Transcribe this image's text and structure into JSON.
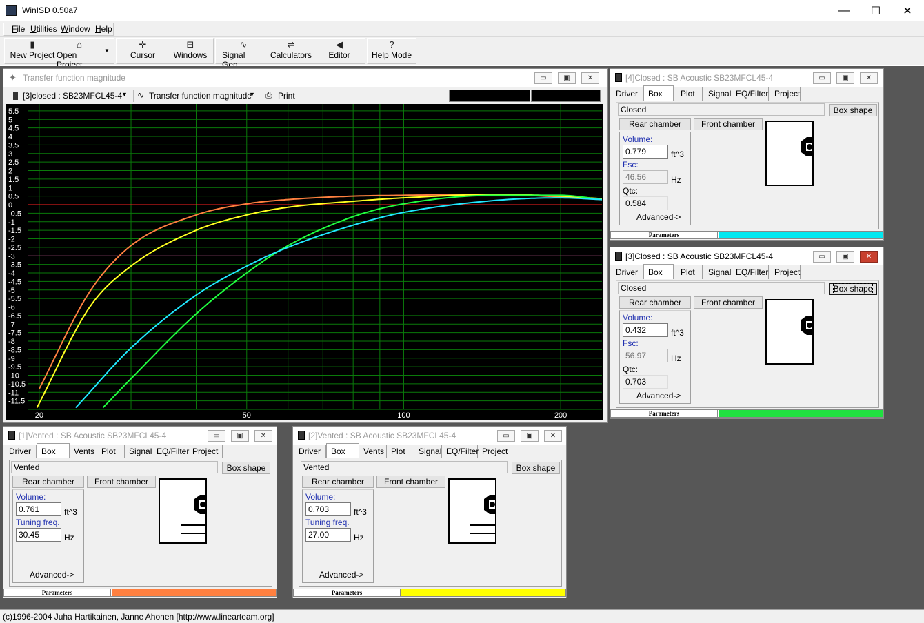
{
  "app": {
    "title": "WinISD 0.50a7",
    "window_controls": [
      "—",
      "☐",
      "✕"
    ]
  },
  "menu": [
    "File",
    "Utilities",
    "Window",
    "Help"
  ],
  "toolbar": {
    "buttons": [
      {
        "label": "New Project",
        "icon": "new-project-icon"
      },
      {
        "label": "Open Project",
        "icon": "open-folder-icon"
      },
      {
        "label": "Cursor",
        "icon": "cursor-icon"
      },
      {
        "label": "Windows",
        "icon": "windows-icon"
      },
      {
        "label": "Signal Gen.",
        "icon": "sine-wave-icon"
      },
      {
        "label": "Calculators",
        "icon": "calculator-icon"
      },
      {
        "label": "Editor",
        "icon": "speaker-icon"
      },
      {
        "label": "Help Mode",
        "icon": "question-icon"
      }
    ]
  },
  "graph_window": {
    "title": "Transfer function magnitude",
    "project_select": "[3]closed : SB23MFCL45-4",
    "graph_select": "Transfer function magnitude",
    "print_label": "Print",
    "controls": [
      "▭",
      "▣",
      "✕"
    ]
  },
  "chart_data": {
    "type": "line",
    "title": "",
    "xlabel": "",
    "ylabel": "",
    "x_scale": "log",
    "xlim": [
      19,
      240
    ],
    "ylim": [
      -12,
      5.9
    ],
    "grid": true,
    "x_ticks": [
      "20",
      "50",
      "100",
      "200"
    ],
    "y_ticks": [
      "5.5",
      "5",
      "4.5",
      "4",
      "3.5",
      "3",
      "2.5",
      "2",
      "1.5",
      "1",
      "0.5",
      "0",
      "-0.5",
      "-1",
      "-1.5",
      "-2",
      "-2.5",
      "-3",
      "-3.5",
      "-4",
      "-4.5",
      "-5",
      "-5.5",
      "-6",
      "-6.5",
      "-7",
      "-7.5",
      "-8",
      "-8.5",
      "-9",
      "-9.5",
      "-10",
      "-10.5",
      "-11",
      "-11.5"
    ],
    "reference_lines": [
      {
        "y": 0,
        "color": "#ff2020"
      },
      {
        "y": -3,
        "color": "#c02090"
      }
    ],
    "series": [
      {
        "color": "#ff8040",
        "x": [
          20,
          25,
          30,
          40,
          50,
          60,
          80,
          100,
          150,
          200,
          240
        ],
        "y": [
          -10.8,
          -5.1,
          -2.4,
          -0.6,
          0.05,
          0.3,
          0.5,
          0.55,
          0.6,
          0.45,
          0.3
        ]
      },
      {
        "color": "#ffff20",
        "x": [
          19.8,
          25,
          30,
          40,
          50,
          60,
          80,
          100,
          150,
          200,
          240
        ],
        "y": [
          -11.9,
          -6.0,
          -3.6,
          -1.5,
          -0.6,
          -0.15,
          0.2,
          0.4,
          0.6,
          0.5,
          0.35
        ]
      },
      {
        "color": "#20ff40",
        "x": [
          26.5,
          30,
          40,
          50,
          60,
          80,
          100,
          150,
          200,
          240
        ],
        "y": [
          -11.9,
          -10.2,
          -6.4,
          -4.0,
          -2.4,
          -0.7,
          0.05,
          0.55,
          0.55,
          0.3
        ]
      },
      {
        "color": "#20e8ff",
        "x": [
          23.5,
          30,
          40,
          50,
          60,
          80,
          100,
          150,
          200,
          240
        ],
        "y": [
          -11.9,
          -8.4,
          -5.3,
          -3.6,
          -2.5,
          -1.2,
          -0.45,
          0.25,
          0.4,
          0.3
        ]
      }
    ]
  },
  "windows": [
    {
      "id": "w4",
      "title": "[4]Closed : SB Acoustic SB23MFCL45-4",
      "active": false,
      "tabs": [
        "Driver",
        "Box",
        "Plot",
        "Signal",
        "EQ/Filter",
        "Project"
      ],
      "selected_tab": "Box",
      "box_type": "Closed",
      "box_shape_label": "Box shape",
      "rear_label": "Rear chamber",
      "front_label": "Front chamber",
      "volume_label": "Volume:",
      "volume": "0.779",
      "volume_unit": "ft^3",
      "freq_label": "Fsc:",
      "freq": "46.56",
      "freq_unit": "Hz",
      "q_label": "Qtc:",
      "q": "0.584",
      "advanced_label": "Advanced->",
      "parameters_label": "Parameters",
      "color": "#00e8f0"
    },
    {
      "id": "w3",
      "title": "[3]Closed : SB Acoustic SB23MFCL45-4",
      "active": true,
      "tabs": [
        "Driver",
        "Box",
        "Plot",
        "Signal",
        "EQ/Filter",
        "Project"
      ],
      "selected_tab": "Box",
      "box_type": "Closed",
      "box_shape_label": "Box shape",
      "rear_label": "Rear chamber",
      "front_label": "Front chamber",
      "volume_label": "Volume:",
      "volume": "0.432",
      "volume_unit": "ft^3",
      "freq_label": "Fsc:",
      "freq": "56.97",
      "freq_unit": "Hz",
      "q_label": "Qtc:",
      "q": "0.703",
      "advanced_label": "Advanced->",
      "parameters_label": "Parameters",
      "color": "#20e040"
    },
    {
      "id": "w1",
      "title": "[1]Vented : SB Acoustic SB23MFCL45-4",
      "active": false,
      "tabs": [
        "Driver",
        "Box",
        "Vents",
        "Plot",
        "Signal",
        "EQ/Filter",
        "Project"
      ],
      "selected_tab": "Box",
      "box_type": "Vented",
      "box_shape_label": "Box shape",
      "rear_label": "Rear chamber",
      "front_label": "Front chamber",
      "volume_label": "Volume:",
      "volume": "0.761",
      "volume_unit": "ft^3",
      "freq_label": "Tuning freq.",
      "freq": "30.45",
      "freq_unit": "Hz",
      "advanced_label": "Advanced->",
      "parameters_label": "Parameters",
      "color": "#ff8040"
    },
    {
      "id": "w2",
      "title": "[2]Vented : SB Acoustic SB23MFCL45-4",
      "active": false,
      "tabs": [
        "Driver",
        "Box",
        "Vents",
        "Plot",
        "Signal",
        "EQ/Filter",
        "Project"
      ],
      "selected_tab": "Box",
      "box_type": "Vented",
      "box_shape_label": "Box shape",
      "rear_label": "Rear chamber",
      "front_label": "Front chamber",
      "volume_label": "Volume:",
      "volume": "0.703",
      "volume_unit": "ft^3",
      "freq_label": "Tuning freq.",
      "freq": "27.00",
      "freq_unit": "Hz",
      "advanced_label": "Advanced->",
      "parameters_label": "Parameters",
      "color": "#ffff00"
    }
  ],
  "status": "(c)1996-2004 Juha Hartikainen, Janne Ahonen [http://www.linearteam.org]"
}
